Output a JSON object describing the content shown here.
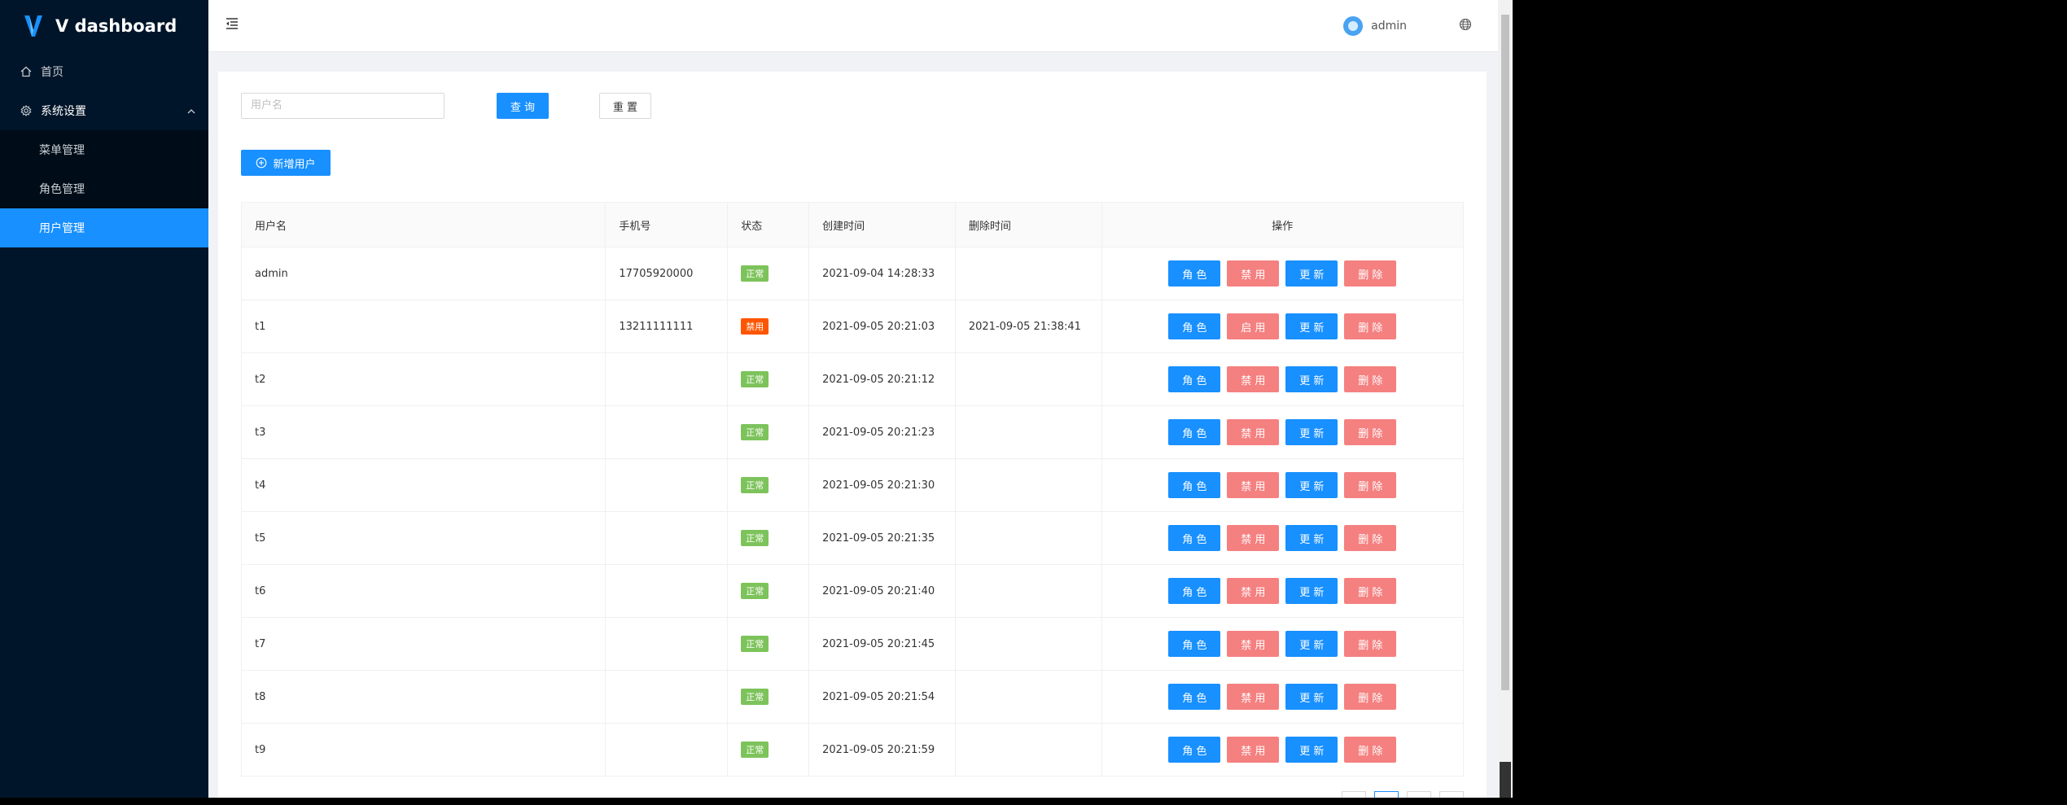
{
  "app": {
    "brand": "V dashboard"
  },
  "sidebar": {
    "home": "首页",
    "system": "系统设置",
    "items": [
      "菜单管理",
      "角色管理",
      "用户管理"
    ]
  },
  "header": {
    "user": "admin"
  },
  "search": {
    "placeholder": "用户名",
    "query_label": "查 询",
    "reset_label": "重 置"
  },
  "toolbar": {
    "add_label": "新增用户"
  },
  "table": {
    "columns": [
      "用户名",
      "手机号",
      "状态",
      "创建时间",
      "删除时间",
      "操作"
    ],
    "actions": {
      "role": "角 色",
      "disable": "禁 用",
      "enable": "启 用",
      "update": "更 新",
      "delete": "删 除"
    },
    "rows": [
      {
        "name": "admin",
        "phone": "17705920000",
        "status": "正常",
        "created": "2021-09-04 14:28:33",
        "deleted": ""
      },
      {
        "name": "t1",
        "phone": "13211111111",
        "status": "禁用",
        "created": "2021-09-05 20:21:03",
        "deleted": "2021-09-05 21:38:41"
      },
      {
        "name": "t2",
        "phone": "",
        "status": "正常",
        "created": "2021-09-05 20:21:12",
        "deleted": ""
      },
      {
        "name": "t3",
        "phone": "",
        "status": "正常",
        "created": "2021-09-05 20:21:23",
        "deleted": ""
      },
      {
        "name": "t4",
        "phone": "",
        "status": "正常",
        "created": "2021-09-05 20:21:30",
        "deleted": ""
      },
      {
        "name": "t5",
        "phone": "",
        "status": "正常",
        "created": "2021-09-05 20:21:35",
        "deleted": ""
      },
      {
        "name": "t6",
        "phone": "",
        "status": "正常",
        "created": "2021-09-05 20:21:40",
        "deleted": ""
      },
      {
        "name": "t7",
        "phone": "",
        "status": "正常",
        "created": "2021-09-05 20:21:45",
        "deleted": ""
      },
      {
        "name": "t8",
        "phone": "",
        "status": "正常",
        "created": "2021-09-05 20:21:54",
        "deleted": ""
      },
      {
        "name": "t9",
        "phone": "",
        "status": "正常",
        "created": "2021-09-05 20:21:59",
        "deleted": ""
      }
    ]
  },
  "colors": {
    "primary": "#1890ff",
    "danger": "#f58080",
    "sidebar": "#001529",
    "ok_tag": "#7dc35b",
    "disabled_tag": "#ff5500"
  }
}
